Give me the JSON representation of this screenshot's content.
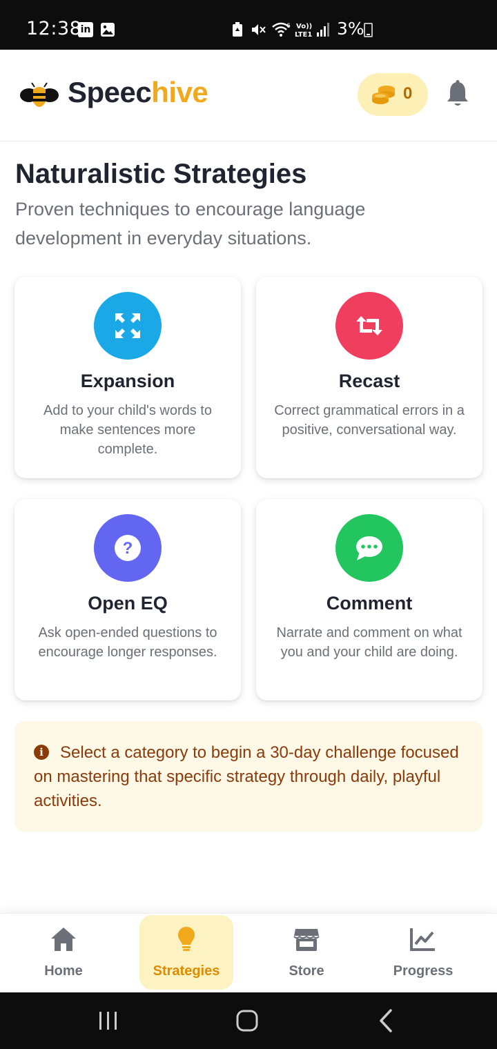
{
  "status_bar": {
    "time": "12:38",
    "battery_text": "3%",
    "icons": [
      "linkedin-icon",
      "image-icon",
      "battery-saver-icon",
      "mute-icon",
      "wifi-icon",
      "volte-icon",
      "signal-icon",
      "battery-icon"
    ]
  },
  "header": {
    "brand_part1": "Speec",
    "brand_part2": "hive",
    "coins": "0",
    "colors": {
      "brand_dark": "#1f2430",
      "brand_accent": "#f0a81c",
      "coin_bg": "#fdf0b6"
    }
  },
  "page": {
    "title": "Naturalistic Strategies",
    "subtitle": "Proven techniques to encourage language development in everyday situations."
  },
  "strategies": [
    {
      "title": "Expansion",
      "description": "Add to your child's words to make sentences more complete.",
      "icon": "expand-arrows-icon",
      "color": "#1ba8e6"
    },
    {
      "title": "Recast",
      "description": "Correct grammatical errors in a positive, conversational way.",
      "icon": "retweet-icon",
      "color": "#ef3e5e"
    },
    {
      "title": "Open EQ",
      "description": "Ask open-ended questions to encourage longer responses.",
      "icon": "question-icon",
      "color": "#6366f1"
    },
    {
      "title": "Comment",
      "description": "Narrate and comment on what you and your child are doing.",
      "icon": "comment-dots-icon",
      "color": "#22c55e"
    }
  ],
  "info": {
    "text": "Select a category to begin a 30-day challenge focused on mastering that specific strategy through daily, playful activities."
  },
  "nav": [
    {
      "label": "Home",
      "icon": "home-icon",
      "active": false
    },
    {
      "label": "Strategies",
      "icon": "lightbulb-icon",
      "active": true
    },
    {
      "label": "Store",
      "icon": "store-icon",
      "active": false
    },
    {
      "label": "Progress",
      "icon": "chart-line-icon",
      "active": false
    }
  ]
}
